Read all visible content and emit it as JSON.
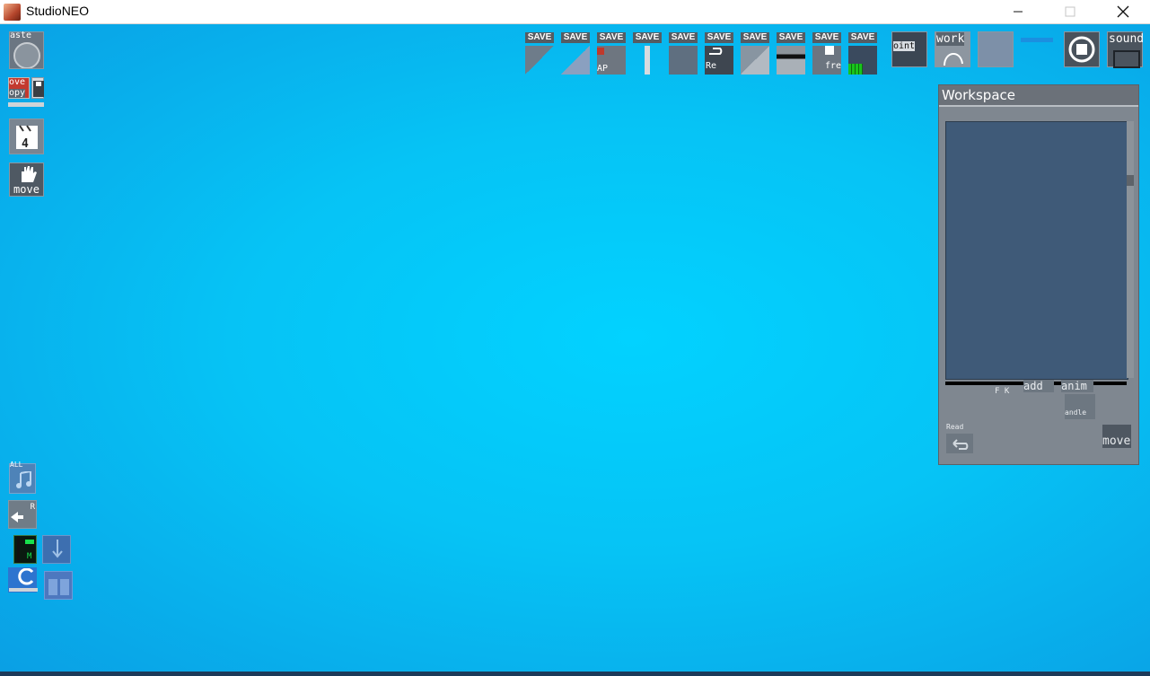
{
  "window": {
    "title": "StudioNEO"
  },
  "left_toolbar": {
    "paste_label": "aste",
    "move_label": "ove",
    "copy_label": "opy",
    "clip_label": "4",
    "hand_label": "move",
    "all_label": "ALL",
    "m_label": "M",
    "r_label": "R"
  },
  "save_slots": [
    "SAVE",
    "SAVE",
    "SAVE",
    "SAVE",
    "SAVE",
    "SAVE",
    "SAVE",
    "SAVE",
    "SAVE",
    "SAVE"
  ],
  "save_thumb_texts": {
    "slot3": "AP",
    "slot6": "Re",
    "slot9": "fre"
  },
  "right_toolbar": {
    "point_label": "oint",
    "work_label": "work",
    "sound_label": "sound"
  },
  "workspace": {
    "title": "Workspace",
    "add_label": "add",
    "anim_label": "anim",
    "candle_label": "andle",
    "move_label": "move",
    "fk_label": "F K",
    "read_label": "Read"
  },
  "colors": {
    "background": "#06c3f5",
    "panel": "#7f8790",
    "list": "#3f5a78"
  }
}
